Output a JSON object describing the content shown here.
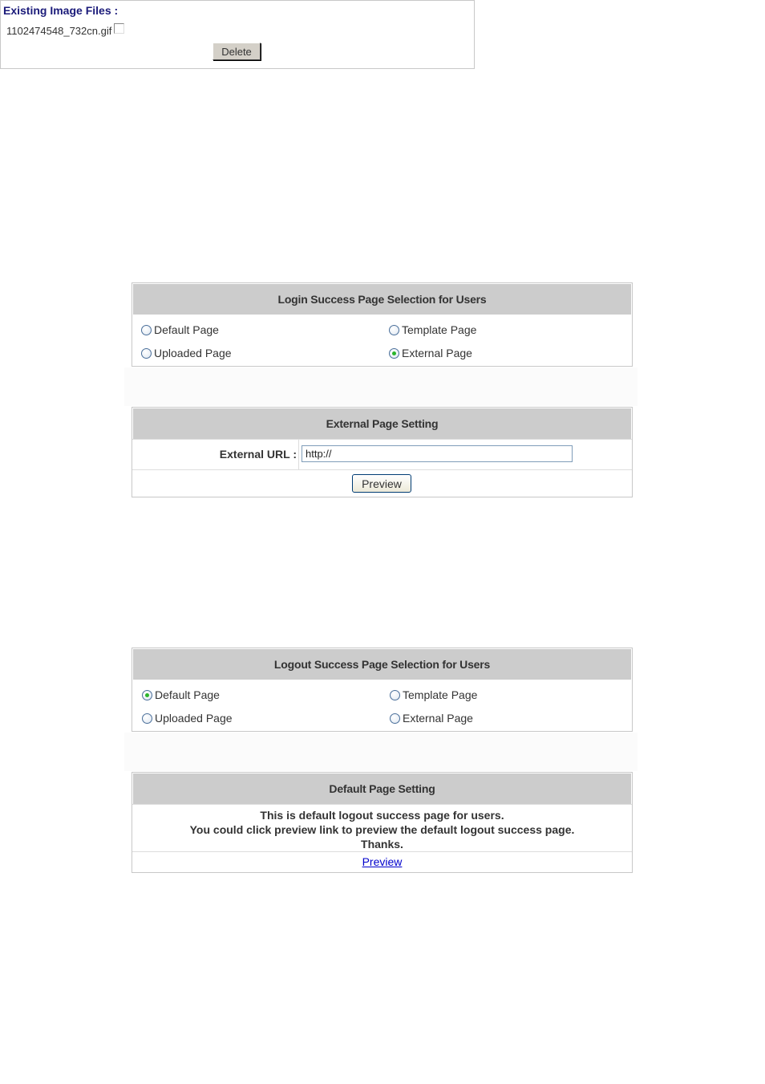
{
  "existing_files": {
    "title": "Existing Image Files :",
    "files": [
      {
        "name": "1102474548_732cn.gif",
        "checked": false
      }
    ],
    "delete_label": "Delete"
  },
  "login_selection": {
    "title": "Login Success Page Selection for Users",
    "options": [
      {
        "label": "Default Page",
        "selected": false
      },
      {
        "label": "Template Page",
        "selected": false
      },
      {
        "label": "Uploaded Page",
        "selected": false
      },
      {
        "label": "External Page",
        "selected": true
      }
    ]
  },
  "external_setting": {
    "title": "External Page Setting",
    "url_label": "External URL :",
    "url_value": "http://",
    "preview_label": "Preview"
  },
  "logout_selection": {
    "title": "Logout Success Page Selection for Users",
    "options": [
      {
        "label": "Default Page",
        "selected": true
      },
      {
        "label": "Template Page",
        "selected": false
      },
      {
        "label": "Uploaded Page",
        "selected": false
      },
      {
        "label": "External Page",
        "selected": false
      }
    ]
  },
  "default_setting": {
    "title": "Default Page Setting",
    "message_lines": [
      "This is default logout success page for users.",
      "You could click preview link to preview the default logout success page.",
      "Thanks."
    ],
    "preview_link": "Preview"
  },
  "colors": {
    "header_bg": "#cccccc",
    "title_blue": "#1b1b7a",
    "radio_selected": "#2bb52b",
    "link": "#0000cc"
  }
}
